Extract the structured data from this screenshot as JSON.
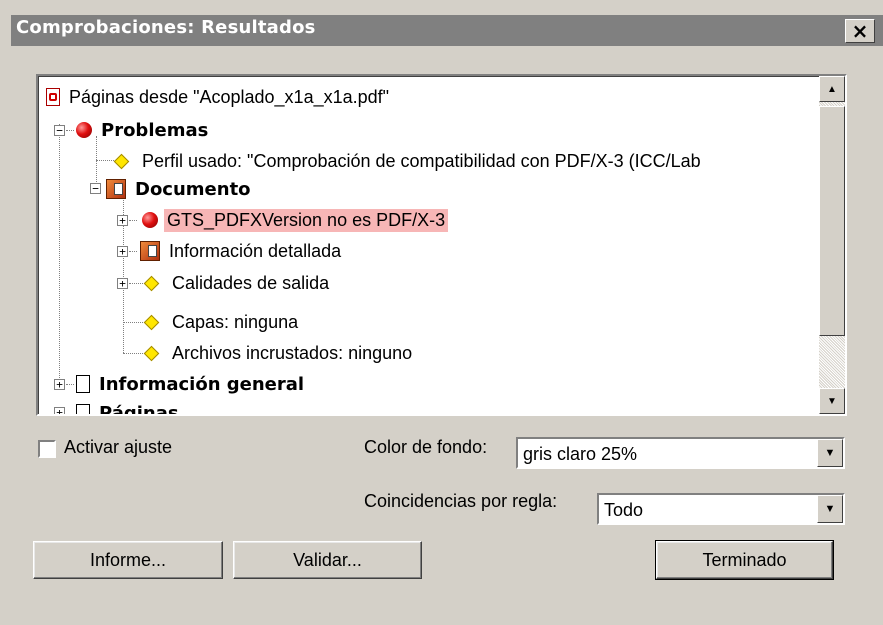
{
  "window": {
    "title": "Comprobaciones: Resultados",
    "close": "×"
  },
  "tree": [
    {
      "label": "Páginas desde \"Acoplado_x1a_x1a.pdf\"",
      "icon": "pdf-icon"
    },
    {
      "label": "Problemas",
      "icon": "red-ball-icon",
      "expander": "−"
    },
    {
      "label": "Perfil usado: \"Comprobación de compatibilidad con PDF/X-3 (ICC/Lab",
      "icon": "yellow-diamond-icon"
    },
    {
      "label": "Documento",
      "icon": "layers-icon",
      "expander": "−"
    },
    {
      "label": "GTS_PDFXVersion no es PDF/X-3",
      "icon": "red-ball-icon",
      "expander": "+"
    },
    {
      "label": "Información detallada",
      "icon": "layers-icon",
      "expander": "+"
    },
    {
      "label": "Calidades de salida",
      "icon": "yellow-diamond-icon",
      "expander": "+"
    },
    {
      "label": "Capas: ninguna",
      "icon": "yellow-diamond-icon"
    },
    {
      "label": "Archivos incrustados: ninguno",
      "icon": "yellow-diamond-icon"
    },
    {
      "label": "Información general",
      "icon": "document-icon",
      "expander": "+"
    },
    {
      "label": "Páginas",
      "icon": "document-icon",
      "expander": "+"
    }
  ],
  "scrollbar": {
    "up": "▲",
    "down": "▼"
  },
  "options": {
    "wrap_label": "Activar ajuste",
    "wrap_checked": false,
    "bg_color_label": "Color de fondo:",
    "bg_color_value": "gris claro 25%",
    "matches_label": "Coincidencias por regla:",
    "matches_value": "Todo",
    "dropdown_arrow": "▼"
  },
  "buttons": {
    "report": "Informe...",
    "validate": "Validar...",
    "done": "Terminado"
  },
  "colors": {
    "highlight": "#f7b6b6",
    "titlebar": "#808080",
    "dialog_bg": "#d4d0c8"
  }
}
